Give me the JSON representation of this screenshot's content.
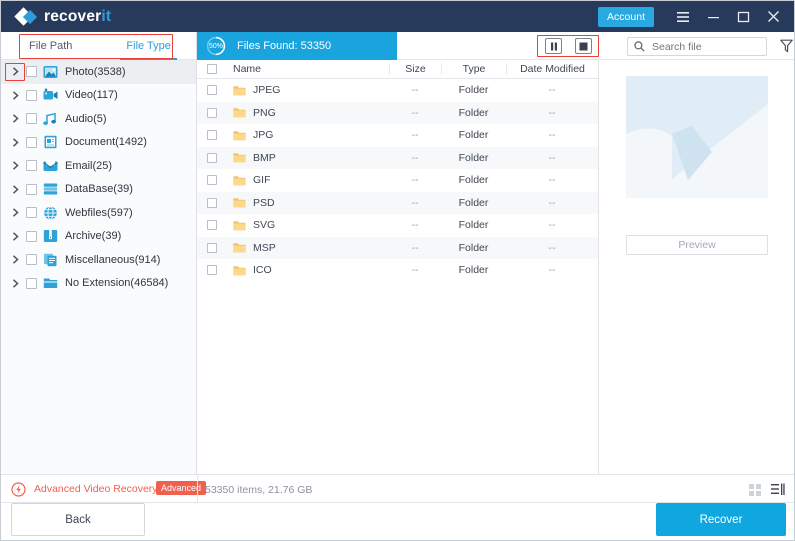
{
  "titlebar": {
    "logo_name": "recover",
    "logo_accent": "it",
    "account_label": "Account",
    "menu_icon": "hamburger-menu-icon",
    "minimize_icon": "minimize-icon",
    "maximize_icon": "maximize-icon",
    "close_icon": "close-icon"
  },
  "left_panel": {
    "tabs": [
      {
        "label": "File Path",
        "active": false
      },
      {
        "label": "File Type",
        "active": true
      }
    ],
    "tree": [
      {
        "label": "Photo(3538)",
        "icon": "photo-icon",
        "selected": true
      },
      {
        "label": "Video(117)",
        "icon": "video-icon",
        "selected": false
      },
      {
        "label": "Audio(5)",
        "icon": "audio-icon",
        "selected": false
      },
      {
        "label": "Document(1492)",
        "icon": "document-icon",
        "selected": false
      },
      {
        "label": "Email(25)",
        "icon": "email-icon",
        "selected": false
      },
      {
        "label": "DataBase(39)",
        "icon": "database-icon",
        "selected": false
      },
      {
        "label": "Webfiles(597)",
        "icon": "globe-icon",
        "selected": false
      },
      {
        "label": "Archive(39)",
        "icon": "archive-icon",
        "selected": false
      },
      {
        "label": "Miscellaneous(914)",
        "icon": "miscellaneous-icon",
        "selected": false
      },
      {
        "label": "No Extension(46584)",
        "icon": "folder-icon",
        "selected": false
      }
    ]
  },
  "scan": {
    "progress_label": "50%",
    "progress_value": 50,
    "files_found_label": "Files Found:  53350"
  },
  "toolbar": {
    "pause_icon": "pause-icon",
    "stop_icon": "stop-icon",
    "search_icon": "search-icon",
    "search_value": "",
    "search_placeholder": "Search file",
    "filter_icon": "filter-funnel-icon"
  },
  "table": {
    "columns": [
      "Name",
      "Size",
      "Type",
      "Date Modified"
    ],
    "rows": [
      {
        "name": "JPEG",
        "size": "--",
        "type": "Folder",
        "date": "--"
      },
      {
        "name": "PNG",
        "size": "--",
        "type": "Folder",
        "date": "--"
      },
      {
        "name": "JPG",
        "size": "--",
        "type": "Folder",
        "date": "--"
      },
      {
        "name": "BMP",
        "size": "--",
        "type": "Folder",
        "date": "--"
      },
      {
        "name": "GIF",
        "size": "--",
        "type": "Folder",
        "date": "--"
      },
      {
        "name": "PSD",
        "size": "--",
        "type": "Folder",
        "date": "--"
      },
      {
        "name": "SVG",
        "size": "--",
        "type": "Folder",
        "date": "--"
      },
      {
        "name": "MSP",
        "size": "--",
        "type": "Folder",
        "date": "--"
      },
      {
        "name": "ICO",
        "size": "--",
        "type": "Folder",
        "date": "--"
      }
    ]
  },
  "preview": {
    "button_label": "Preview",
    "placeholder_icon": "image-placeholder-icon"
  },
  "statusbar": {
    "advanced_recovery_label": "Advanced Video Recovery",
    "advanced_badge": "Advanced",
    "items_label": "53350 items, 21.76  GB",
    "grid_view_icon": "grid-view-icon",
    "list_view_icon": "list-view-icon"
  },
  "footer": {
    "back_label": "Back",
    "recover_label": "Recover"
  },
  "colors": {
    "header_bg": "#283a5b",
    "accent_blue": "#29a9e1",
    "scan_blue": "#19a4de",
    "recover_blue": "#10a7e0",
    "annotation_red": "#e8413a",
    "advanced_red": "#f0604d"
  }
}
